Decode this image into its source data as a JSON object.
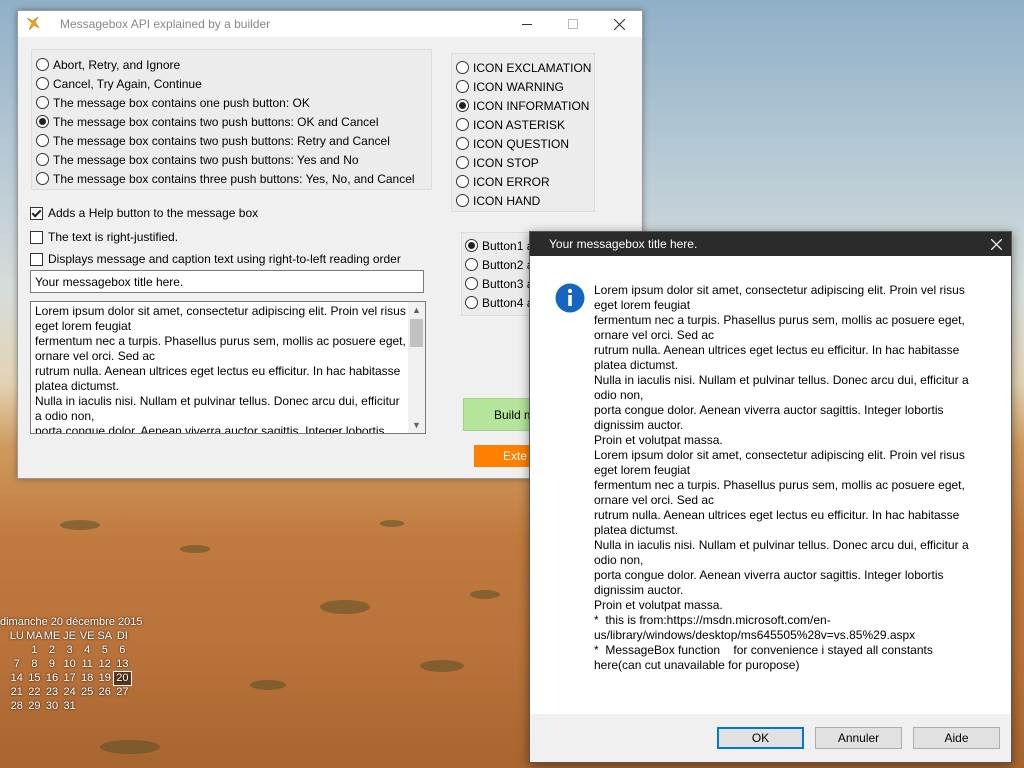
{
  "main_window": {
    "title": "Messagebox API explained by a builder",
    "button_types": [
      {
        "label": "Abort, Retry, and Ignore",
        "checked": false
      },
      {
        "label": "Cancel, Try Again, Continue",
        "checked": false
      },
      {
        "label": "The message box contains one push button: OK",
        "checked": false
      },
      {
        "label": "The message box contains two push buttons: OK and Cancel",
        "checked": true
      },
      {
        "label": "The message box contains two push buttons: Retry and Cancel",
        "checked": false
      },
      {
        "label": "The message box contains two push buttons: Yes and No",
        "checked": false
      },
      {
        "label": "The message box contains three push buttons: Yes, No, and Cancel",
        "checked": false
      }
    ],
    "icons": [
      {
        "label": "ICON EXCLAMATION",
        "checked": false
      },
      {
        "label": "ICON WARNING",
        "checked": false
      },
      {
        "label": "ICON INFORMATION",
        "checked": true
      },
      {
        "label": "ICON ASTERISK",
        "checked": false
      },
      {
        "label": "ICON QUESTION",
        "checked": false
      },
      {
        "label": "ICON STOP",
        "checked": false
      },
      {
        "label": "ICON ERROR",
        "checked": false
      },
      {
        "label": "ICON HAND",
        "checked": false
      }
    ],
    "default_buttons": [
      {
        "label": "Button1 a",
        "checked": true
      },
      {
        "label": "Button2 a",
        "checked": false
      },
      {
        "label": "Button3 a",
        "checked": false
      },
      {
        "label": "Button4 a",
        "checked": false
      }
    ],
    "options": [
      {
        "label": "Adds a Help button to the message box",
        "checked": true
      },
      {
        "label": "The text is right-justified.",
        "checked": false
      },
      {
        "label": "Displays message and caption text using right-to-left reading order",
        "checked": false
      }
    ],
    "title_input_value": "Your messagebox title here.",
    "message_text": "Lorem ipsum dolor sit amet, consectetur adipiscing elit. Proin vel risus eget lorem feugiat\nfermentum nec a turpis. Phasellus purus sem, mollis ac posuere eget, ornare vel orci. Sed ac\nrutrum nulla. Aenean ultrices eget lectus eu efficitur. In hac habitasse platea dictumst.\nNulla in iaculis nisi. Nullam et pulvinar tellus. Donec arcu dui, efficitur a odio non,\nporta congue dolor. Aenean viverra auctor sagittis. Integer lobortis",
    "build_label": "Build m",
    "exit_label": "Exte"
  },
  "msgbox": {
    "title": "Your messagebox title here.",
    "text": "Lorem ipsum dolor sit amet, consectetur adipiscing elit. Proin vel risus eget lorem feugiat\nfermentum nec a turpis. Phasellus purus sem, mollis ac posuere eget, ornare vel orci. Sed ac\nrutrum nulla. Aenean ultrices eget lectus eu efficitur. In hac habitasse platea dictumst.\nNulla in iaculis nisi. Nullam et pulvinar tellus. Donec arcu dui, efficitur a odio non,\nporta congue dolor. Aenean viverra auctor sagittis. Integer lobortis dignissim auctor.\nProin et volutpat massa.\nLorem ipsum dolor sit amet, consectetur adipiscing elit. Proin vel risus eget lorem feugiat\nfermentum nec a turpis. Phasellus purus sem, mollis ac posuere eget, ornare vel orci. Sed ac\nrutrum nulla. Aenean ultrices eget lectus eu efficitur. In hac habitasse platea dictumst.\nNulla in iaculis nisi. Nullam et pulvinar tellus. Donec arcu dui, efficitur a odio non,\nporta congue dolor. Aenean viverra auctor sagittis. Integer lobortis dignissim auctor.\nProin et volutpat massa.\n*  this is from:https://msdn.microsoft.com/en-us/library/windows/desktop/ms645505%28v=vs.85%29.aspx\n*  MessageBox function    for convenience i stayed all constants here(can cut unavailable for puropose)",
    "ok_label": "OK",
    "cancel_label": "Annuler",
    "help_label": "Aide"
  },
  "calendar": {
    "title": "dimanche 20 décembre 2015",
    "day_headers": [
      "LU",
      "MA",
      "ME",
      "JE",
      "VE",
      "SA",
      "DI"
    ],
    "days": [
      "",
      "1",
      "2",
      "3",
      "4",
      "5",
      "6",
      "7",
      "8",
      "9",
      "10",
      "11",
      "12",
      "13",
      "14",
      "15",
      "16",
      "17",
      "18",
      "19",
      "20",
      "21",
      "22",
      "23",
      "24",
      "25",
      "26",
      "27",
      "28",
      "29",
      "30",
      "31"
    ],
    "today": "20"
  }
}
